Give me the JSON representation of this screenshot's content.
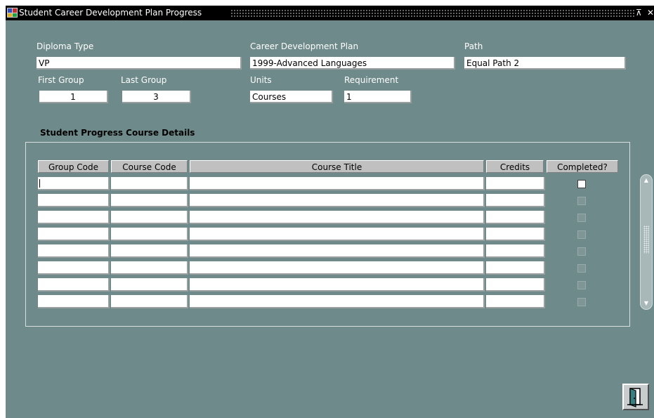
{
  "window": {
    "title": "Student Career Development Plan Progress",
    "restore_glyph": "⊼",
    "close_glyph": "✕"
  },
  "form": {
    "diploma_type": {
      "label": "Diploma Type",
      "value": "VP"
    },
    "career_development_plan": {
      "label": "Career Development Plan",
      "value": "1999-Advanced Languages"
    },
    "path": {
      "label": "Path",
      "value": "Equal Path 2"
    },
    "first_group": {
      "label": "First Group",
      "value": "1"
    },
    "last_group": {
      "label": "Last Group",
      "value": "3"
    },
    "units": {
      "label": "Units",
      "value": "Courses"
    },
    "requirement": {
      "label": "Requirement",
      "value": "1"
    }
  },
  "details": {
    "title": "Student Progress Course Details",
    "columns": [
      "Group Code",
      "Course Code",
      "Course Title",
      "Credits",
      "Completed?"
    ],
    "rows": [
      {
        "group_code": "",
        "course_code": "",
        "course_title": "",
        "credits": "",
        "completed": false
      },
      {
        "group_code": "",
        "course_code": "",
        "course_title": "",
        "credits": "",
        "completed": false
      },
      {
        "group_code": "",
        "course_code": "",
        "course_title": "",
        "credits": "",
        "completed": false
      },
      {
        "group_code": "",
        "course_code": "",
        "course_title": "",
        "credits": "",
        "completed": false
      },
      {
        "group_code": "",
        "course_code": "",
        "course_title": "",
        "credits": "",
        "completed": false
      },
      {
        "group_code": "",
        "course_code": "",
        "course_title": "",
        "credits": "",
        "completed": false
      },
      {
        "group_code": "",
        "course_code": "",
        "course_title": "",
        "credits": "",
        "completed": false
      },
      {
        "group_code": "",
        "course_code": "",
        "course_title": "",
        "credits": "",
        "completed": false
      }
    ]
  },
  "icons": {
    "app": "app-icon",
    "exit": "exit-door-icon",
    "scroll_up": "scroll-up-icon",
    "scroll_down": "scroll-down-icon"
  },
  "colors": {
    "background": "#6f8a8a",
    "titlebar": "#000000",
    "field": "#ffffff",
    "header": "#c0c0c0"
  }
}
